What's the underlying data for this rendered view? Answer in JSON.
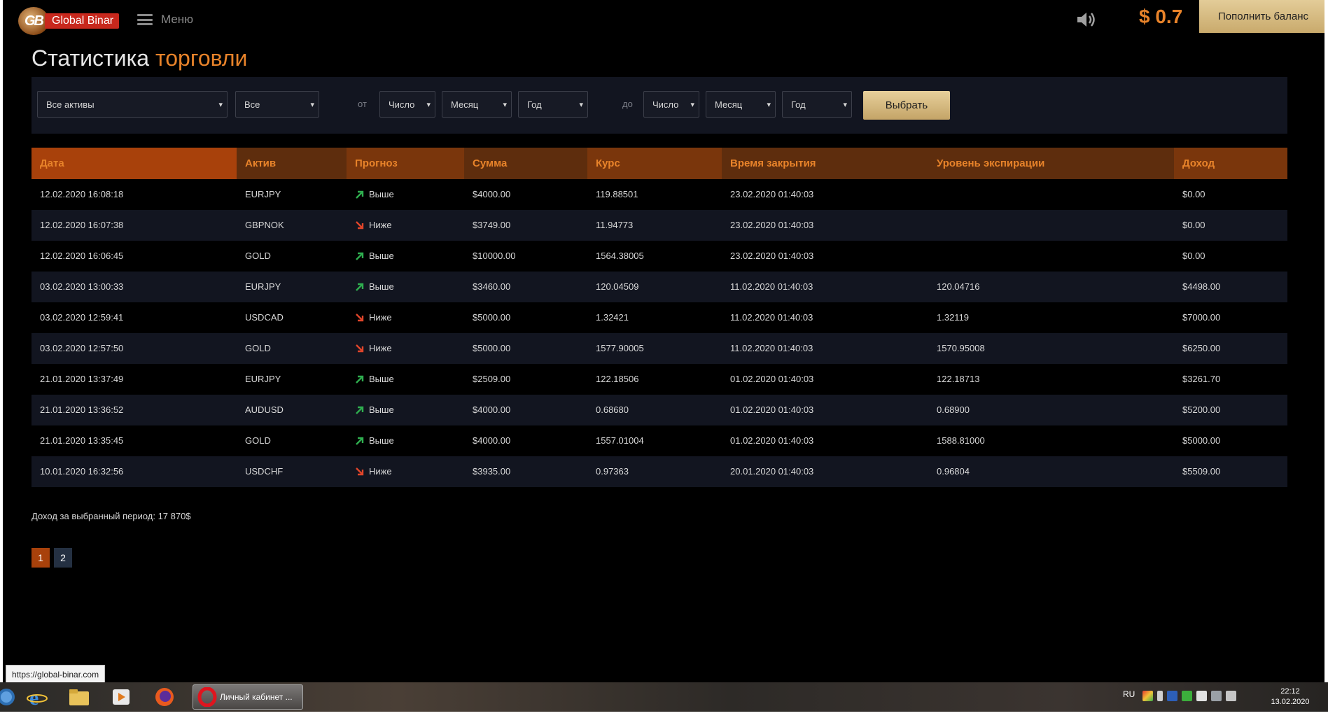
{
  "header": {
    "logo_text": "Global Binar",
    "logo_mark": "GB",
    "menu_label": "Меню",
    "balance": "$ 0.7",
    "topup_label": "Пополнить баланс"
  },
  "page": {
    "title_main": "Статистика",
    "title_accent": "торговли"
  },
  "filters": {
    "asset": "Все активы",
    "type": "Все",
    "from_label": "от",
    "from_day": "Число",
    "from_month": "Месяц",
    "from_year": "Год",
    "to_label": "до",
    "to_day": "Число",
    "to_month": "Месяц",
    "to_year": "Год",
    "choose_label": "Выбрать"
  },
  "table": {
    "headers": [
      "Дата",
      "Актив",
      "Прогноз",
      "Сумма",
      "Курс",
      "Время закрытия",
      "Уровень экспирации",
      "Доход"
    ],
    "rows": [
      {
        "date": "12.02.2020 16:08:18",
        "asset": "EURJPY",
        "dir": "up",
        "forecast": "Выше",
        "sum": "$4000.00",
        "rate": "119.88501",
        "close": "23.02.2020 01:40:03",
        "exp": "",
        "income": "$0.00"
      },
      {
        "date": "12.02.2020 16:07:38",
        "asset": "GBPNOK",
        "dir": "down",
        "forecast": "Ниже",
        "sum": "$3749.00",
        "rate": "11.94773",
        "close": "23.02.2020 01:40:03",
        "exp": "",
        "income": "$0.00"
      },
      {
        "date": "12.02.2020 16:06:45",
        "asset": "GOLD",
        "dir": "up",
        "forecast": "Выше",
        "sum": "$10000.00",
        "rate": "1564.38005",
        "close": "23.02.2020 01:40:03",
        "exp": "",
        "income": "$0.00"
      },
      {
        "date": "03.02.2020 13:00:33",
        "asset": "EURJPY",
        "dir": "up",
        "forecast": "Выше",
        "sum": "$3460.00",
        "rate": "120.04509",
        "close": "11.02.2020 01:40:03",
        "exp": "120.04716",
        "income": "$4498.00"
      },
      {
        "date": "03.02.2020 12:59:41",
        "asset": "USDCAD",
        "dir": "down",
        "forecast": "Ниже",
        "sum": "$5000.00",
        "rate": "1.32421",
        "close": "11.02.2020 01:40:03",
        "exp": "1.32119",
        "income": "$7000.00"
      },
      {
        "date": "03.02.2020 12:57:50",
        "asset": "GOLD",
        "dir": "down",
        "forecast": "Ниже",
        "sum": "$5000.00",
        "rate": "1577.90005",
        "close": "11.02.2020 01:40:03",
        "exp": "1570.95008",
        "income": "$6250.00"
      },
      {
        "date": "21.01.2020 13:37:49",
        "asset": "EURJPY",
        "dir": "up",
        "forecast": "Выше",
        "sum": "$2509.00",
        "rate": "122.18506",
        "close": "01.02.2020 01:40:03",
        "exp": "122.18713",
        "income": "$3261.70"
      },
      {
        "date": "21.01.2020 13:36:52",
        "asset": "AUDUSD",
        "dir": "up",
        "forecast": "Выше",
        "sum": "$4000.00",
        "rate": "0.68680",
        "close": "01.02.2020 01:40:03",
        "exp": "0.68900",
        "income": "$5200.00"
      },
      {
        "date": "21.01.2020 13:35:45",
        "asset": "GOLD",
        "dir": "up",
        "forecast": "Выше",
        "sum": "$4000.00",
        "rate": "1557.01004",
        "close": "01.02.2020 01:40:03",
        "exp": "1588.81000",
        "income": "$5000.00"
      },
      {
        "date": "10.01.2020 16:32:56",
        "asset": "USDCHF",
        "dir": "down",
        "forecast": "Ниже",
        "sum": "$3935.00",
        "rate": "0.97363",
        "close": "20.01.2020 01:40:03",
        "exp": "0.96804",
        "income": "$5509.00"
      }
    ]
  },
  "summary": {
    "total_text": "Доход за выбранный период: 17 870$"
  },
  "pagination": {
    "pages": [
      "1",
      "2"
    ],
    "active": "1"
  },
  "browser": {
    "status_url": "https://global-binar.com"
  },
  "taskbar": {
    "active_task": "Личный кабинет ...",
    "lang": "RU",
    "time": "22:12",
    "date": "13.02.2020"
  },
  "colors": {
    "accent": "#e8832a",
    "header_row": "#5e2d0d",
    "up_arrow": "#2fae4f",
    "down_arrow": "#e0452a",
    "button_gold": "#d4b87f"
  },
  "icons": {
    "up": "arrow-up-right-icon",
    "down": "arrow-down-right-icon"
  }
}
